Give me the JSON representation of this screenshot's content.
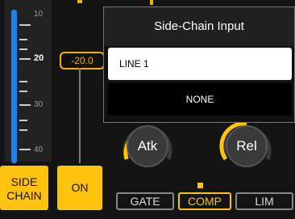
{
  "meter": {
    "labels": [
      "10",
      "20",
      "30",
      "40"
    ],
    "highlighted": "20"
  },
  "fader": {
    "value": "-20.0"
  },
  "buttons": {
    "sidechain_line1": "SIDE",
    "sidechain_line2": "CHAIN",
    "on": "ON"
  },
  "knobs": {
    "attack": "Atk",
    "release": "Rel"
  },
  "tabs": {
    "gate": "GATE",
    "comp": "COMP",
    "lim": "LIM",
    "active": "COMP"
  },
  "popup": {
    "title": "Side-Chain Input",
    "options": [
      "LINE 1",
      "NONE"
    ],
    "selected": "LINE 1"
  },
  "colors": {
    "accent": "#ffc20e",
    "meter": "#2a7fe3",
    "background": "#141414"
  }
}
